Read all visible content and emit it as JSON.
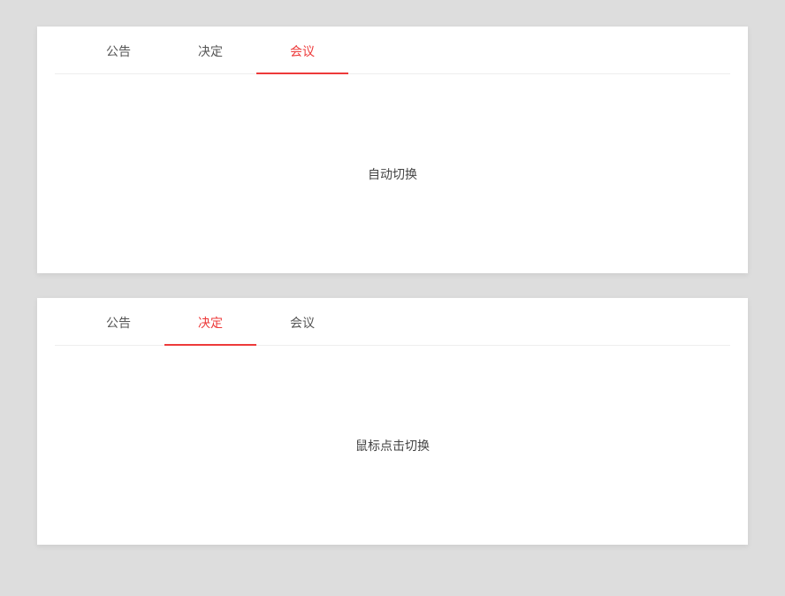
{
  "card1": {
    "tabs": [
      {
        "label": "公告",
        "active": false
      },
      {
        "label": "决定",
        "active": false
      },
      {
        "label": "会议",
        "active": true
      }
    ],
    "content": "自动切换"
  },
  "card2": {
    "tabs": [
      {
        "label": "公告",
        "active": false
      },
      {
        "label": "决定",
        "active": true
      },
      {
        "label": "会议",
        "active": false
      }
    ],
    "content": "鼠标点击切换"
  }
}
